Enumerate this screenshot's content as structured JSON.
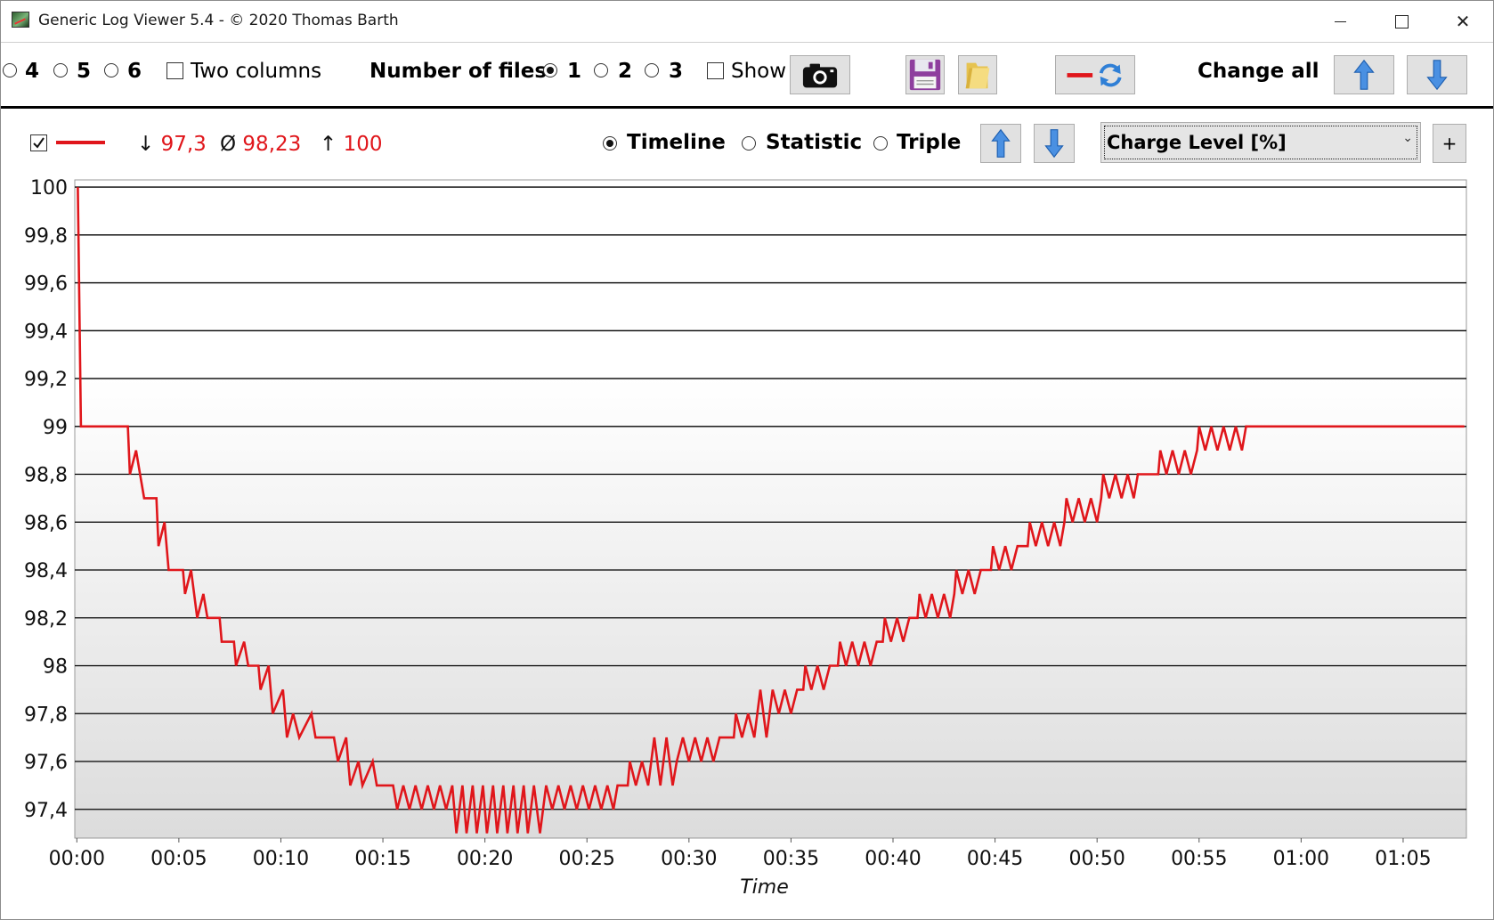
{
  "window": {
    "title": "Generic Log Viewer 5.4 - © 2020 Thomas Barth",
    "minimize_label": "—",
    "maximize_label": "☐",
    "close_label": "✕"
  },
  "toolbar": {
    "columns_options": [
      {
        "label": "4",
        "selected": false
      },
      {
        "label": "5",
        "selected": false
      },
      {
        "label": "6",
        "selected": false
      }
    ],
    "two_columns_label": "Two columns",
    "two_columns_checked": false,
    "number_of_files_label": "Number of files",
    "files_options": [
      {
        "label": "1",
        "selected": true
      },
      {
        "label": "2",
        "selected": false
      },
      {
        "label": "3",
        "selected": false
      }
    ],
    "show_label": "Show",
    "show_checked": false,
    "change_all_label": "Change all",
    "icons": {
      "camera": "camera-icon",
      "save": "floppy-disk-icon",
      "open": "folder-icon",
      "refresh": "line-refresh-icon",
      "up": "arrow-up-icon",
      "down": "arrow-down-icon"
    }
  },
  "series_bar": {
    "visible_checked": true,
    "line_color": "#e0161b",
    "min_symbol": "↓",
    "min_value": "97,3",
    "avg_symbol": "Ø",
    "avg_value": "98,23",
    "max_symbol": "↑",
    "max_value": "100",
    "view_options": [
      {
        "label": "Timeline",
        "selected": true
      },
      {
        "label": "Statistic",
        "selected": false
      },
      {
        "label": "Triple",
        "selected": false
      }
    ],
    "channel_select": "Charge Level [%]",
    "add_label": "+"
  },
  "chart_data": {
    "type": "line",
    "xlabel": "Time",
    "ylabel": "",
    "title": "",
    "x_ticks": [
      "00:00",
      "00:05",
      "00:10",
      "00:15",
      "00:20",
      "00:25",
      "00:30",
      "00:35",
      "00:40",
      "00:45",
      "00:50",
      "00:55",
      "01:00",
      "01:05"
    ],
    "y_ticks": [
      "97,4",
      "97,6",
      "97,8",
      "98",
      "98,2",
      "98,4",
      "98,6",
      "98,8",
      "99",
      "99,2",
      "99,4",
      "99,6",
      "99,8",
      "100"
    ],
    "ylim": [
      97.28,
      100.03
    ],
    "xlim_minutes": [
      -0.1,
      68.1
    ],
    "grid": true,
    "series": [
      {
        "color": "#e0161b",
        "points": [
          [
            0.05,
            100.0
          ],
          [
            0.2,
            99.0
          ],
          [
            2.5,
            99.0
          ],
          [
            2.6,
            98.8
          ],
          [
            2.9,
            98.9
          ],
          [
            3.1,
            98.8
          ],
          [
            3.3,
            98.7
          ],
          [
            3.9,
            98.7
          ],
          [
            4.0,
            98.5
          ],
          [
            4.3,
            98.6
          ],
          [
            4.5,
            98.4
          ],
          [
            5.2,
            98.4
          ],
          [
            5.3,
            98.3
          ],
          [
            5.6,
            98.4
          ],
          [
            5.9,
            98.2
          ],
          [
            6.2,
            98.3
          ],
          [
            6.4,
            98.2
          ],
          [
            7.0,
            98.2
          ],
          [
            7.1,
            98.1
          ],
          [
            7.7,
            98.1
          ],
          [
            7.8,
            98.0
          ],
          [
            8.2,
            98.1
          ],
          [
            8.4,
            98.0
          ],
          [
            8.9,
            98.0
          ],
          [
            9.0,
            97.9
          ],
          [
            9.4,
            98.0
          ],
          [
            9.6,
            97.8
          ],
          [
            10.1,
            97.9
          ],
          [
            10.3,
            97.7
          ],
          [
            10.6,
            97.8
          ],
          [
            10.9,
            97.7
          ],
          [
            11.5,
            97.8
          ],
          [
            11.7,
            97.7
          ],
          [
            12.6,
            97.7
          ],
          [
            12.8,
            97.6
          ],
          [
            13.2,
            97.7
          ],
          [
            13.4,
            97.5
          ],
          [
            13.8,
            97.6
          ],
          [
            14.0,
            97.5
          ],
          [
            14.5,
            97.6
          ],
          [
            14.7,
            97.5
          ],
          [
            15.5,
            97.5
          ],
          [
            15.7,
            97.4
          ],
          [
            16.0,
            97.5
          ],
          [
            16.3,
            97.4
          ],
          [
            16.6,
            97.5
          ],
          [
            16.9,
            97.4
          ],
          [
            17.2,
            97.5
          ],
          [
            17.5,
            97.4
          ],
          [
            17.8,
            97.5
          ],
          [
            18.1,
            97.4
          ],
          [
            18.4,
            97.5
          ],
          [
            18.6,
            97.3
          ],
          [
            18.9,
            97.5
          ],
          [
            19.1,
            97.3
          ],
          [
            19.4,
            97.5
          ],
          [
            19.6,
            97.3
          ],
          [
            19.9,
            97.5
          ],
          [
            20.1,
            97.3
          ],
          [
            20.4,
            97.5
          ],
          [
            20.6,
            97.3
          ],
          [
            20.9,
            97.5
          ],
          [
            21.1,
            97.3
          ],
          [
            21.4,
            97.5
          ],
          [
            21.6,
            97.3
          ],
          [
            21.9,
            97.5
          ],
          [
            22.1,
            97.3
          ],
          [
            22.4,
            97.5
          ],
          [
            22.7,
            97.3
          ],
          [
            23.0,
            97.5
          ],
          [
            23.3,
            97.4
          ],
          [
            23.6,
            97.5
          ],
          [
            23.9,
            97.4
          ],
          [
            24.2,
            97.5
          ],
          [
            24.5,
            97.4
          ],
          [
            24.8,
            97.5
          ],
          [
            25.1,
            97.4
          ],
          [
            25.4,
            97.5
          ],
          [
            25.7,
            97.4
          ],
          [
            26.0,
            97.5
          ],
          [
            26.3,
            97.4
          ],
          [
            26.5,
            97.5
          ],
          [
            27.0,
            97.5
          ],
          [
            27.1,
            97.6
          ],
          [
            27.4,
            97.5
          ],
          [
            27.7,
            97.6
          ],
          [
            28.0,
            97.5
          ],
          [
            28.3,
            97.7
          ],
          [
            28.6,
            97.5
          ],
          [
            28.9,
            97.7
          ],
          [
            29.2,
            97.5
          ],
          [
            29.4,
            97.6
          ],
          [
            29.7,
            97.7
          ],
          [
            30.0,
            97.6
          ],
          [
            30.3,
            97.7
          ],
          [
            30.6,
            97.6
          ],
          [
            30.9,
            97.7
          ],
          [
            31.2,
            97.6
          ],
          [
            31.5,
            97.7
          ],
          [
            32.2,
            97.7
          ],
          [
            32.3,
            97.8
          ],
          [
            32.6,
            97.7
          ],
          [
            32.9,
            97.8
          ],
          [
            33.2,
            97.7
          ],
          [
            33.5,
            97.9
          ],
          [
            33.8,
            97.7
          ],
          [
            34.1,
            97.9
          ],
          [
            34.4,
            97.8
          ],
          [
            34.7,
            97.9
          ],
          [
            35.0,
            97.8
          ],
          [
            35.3,
            97.9
          ],
          [
            35.6,
            97.9
          ],
          [
            35.7,
            98.0
          ],
          [
            36.0,
            97.9
          ],
          [
            36.3,
            98.0
          ],
          [
            36.6,
            97.9
          ],
          [
            36.9,
            98.0
          ],
          [
            37.3,
            98.0
          ],
          [
            37.4,
            98.1
          ],
          [
            37.7,
            98.0
          ],
          [
            38.0,
            98.1
          ],
          [
            38.3,
            98.0
          ],
          [
            38.6,
            98.1
          ],
          [
            38.9,
            98.0
          ],
          [
            39.2,
            98.1
          ],
          [
            39.5,
            98.1
          ],
          [
            39.6,
            98.2
          ],
          [
            39.9,
            98.1
          ],
          [
            40.2,
            98.2
          ],
          [
            40.5,
            98.1
          ],
          [
            40.8,
            98.2
          ],
          [
            41.2,
            98.2
          ],
          [
            41.3,
            98.3
          ],
          [
            41.6,
            98.2
          ],
          [
            41.9,
            98.3
          ],
          [
            42.2,
            98.2
          ],
          [
            42.5,
            98.3
          ],
          [
            42.8,
            98.2
          ],
          [
            43.0,
            98.3
          ],
          [
            43.1,
            98.4
          ],
          [
            43.4,
            98.3
          ],
          [
            43.7,
            98.4
          ],
          [
            44.0,
            98.3
          ],
          [
            44.3,
            98.4
          ],
          [
            44.8,
            98.4
          ],
          [
            44.9,
            98.5
          ],
          [
            45.2,
            98.4
          ],
          [
            45.5,
            98.5
          ],
          [
            45.8,
            98.4
          ],
          [
            46.1,
            98.5
          ],
          [
            46.6,
            98.5
          ],
          [
            46.7,
            98.6
          ],
          [
            47.0,
            98.5
          ],
          [
            47.3,
            98.6
          ],
          [
            47.6,
            98.5
          ],
          [
            47.9,
            98.6
          ],
          [
            48.2,
            98.5
          ],
          [
            48.4,
            98.6
          ],
          [
            48.5,
            98.7
          ],
          [
            48.8,
            98.6
          ],
          [
            49.1,
            98.7
          ],
          [
            49.4,
            98.6
          ],
          [
            49.7,
            98.7
          ],
          [
            50.0,
            98.6
          ],
          [
            50.2,
            98.7
          ],
          [
            50.3,
            98.8
          ],
          [
            50.6,
            98.7
          ],
          [
            50.9,
            98.8
          ],
          [
            51.2,
            98.7
          ],
          [
            51.5,
            98.8
          ],
          [
            51.8,
            98.7
          ],
          [
            52.0,
            98.8
          ],
          [
            53.0,
            98.8
          ],
          [
            53.1,
            98.9
          ],
          [
            53.4,
            98.8
          ],
          [
            53.7,
            98.9
          ],
          [
            54.0,
            98.8
          ],
          [
            54.3,
            98.9
          ],
          [
            54.6,
            98.8
          ],
          [
            54.9,
            98.9
          ],
          [
            55.0,
            99.0
          ],
          [
            55.3,
            98.9
          ],
          [
            55.6,
            99.0
          ],
          [
            55.9,
            98.9
          ],
          [
            56.2,
            99.0
          ],
          [
            56.5,
            98.9
          ],
          [
            56.8,
            99.0
          ],
          [
            57.1,
            98.9
          ],
          [
            57.3,
            99.0
          ],
          [
            68.0,
            99.0
          ]
        ]
      }
    ]
  }
}
